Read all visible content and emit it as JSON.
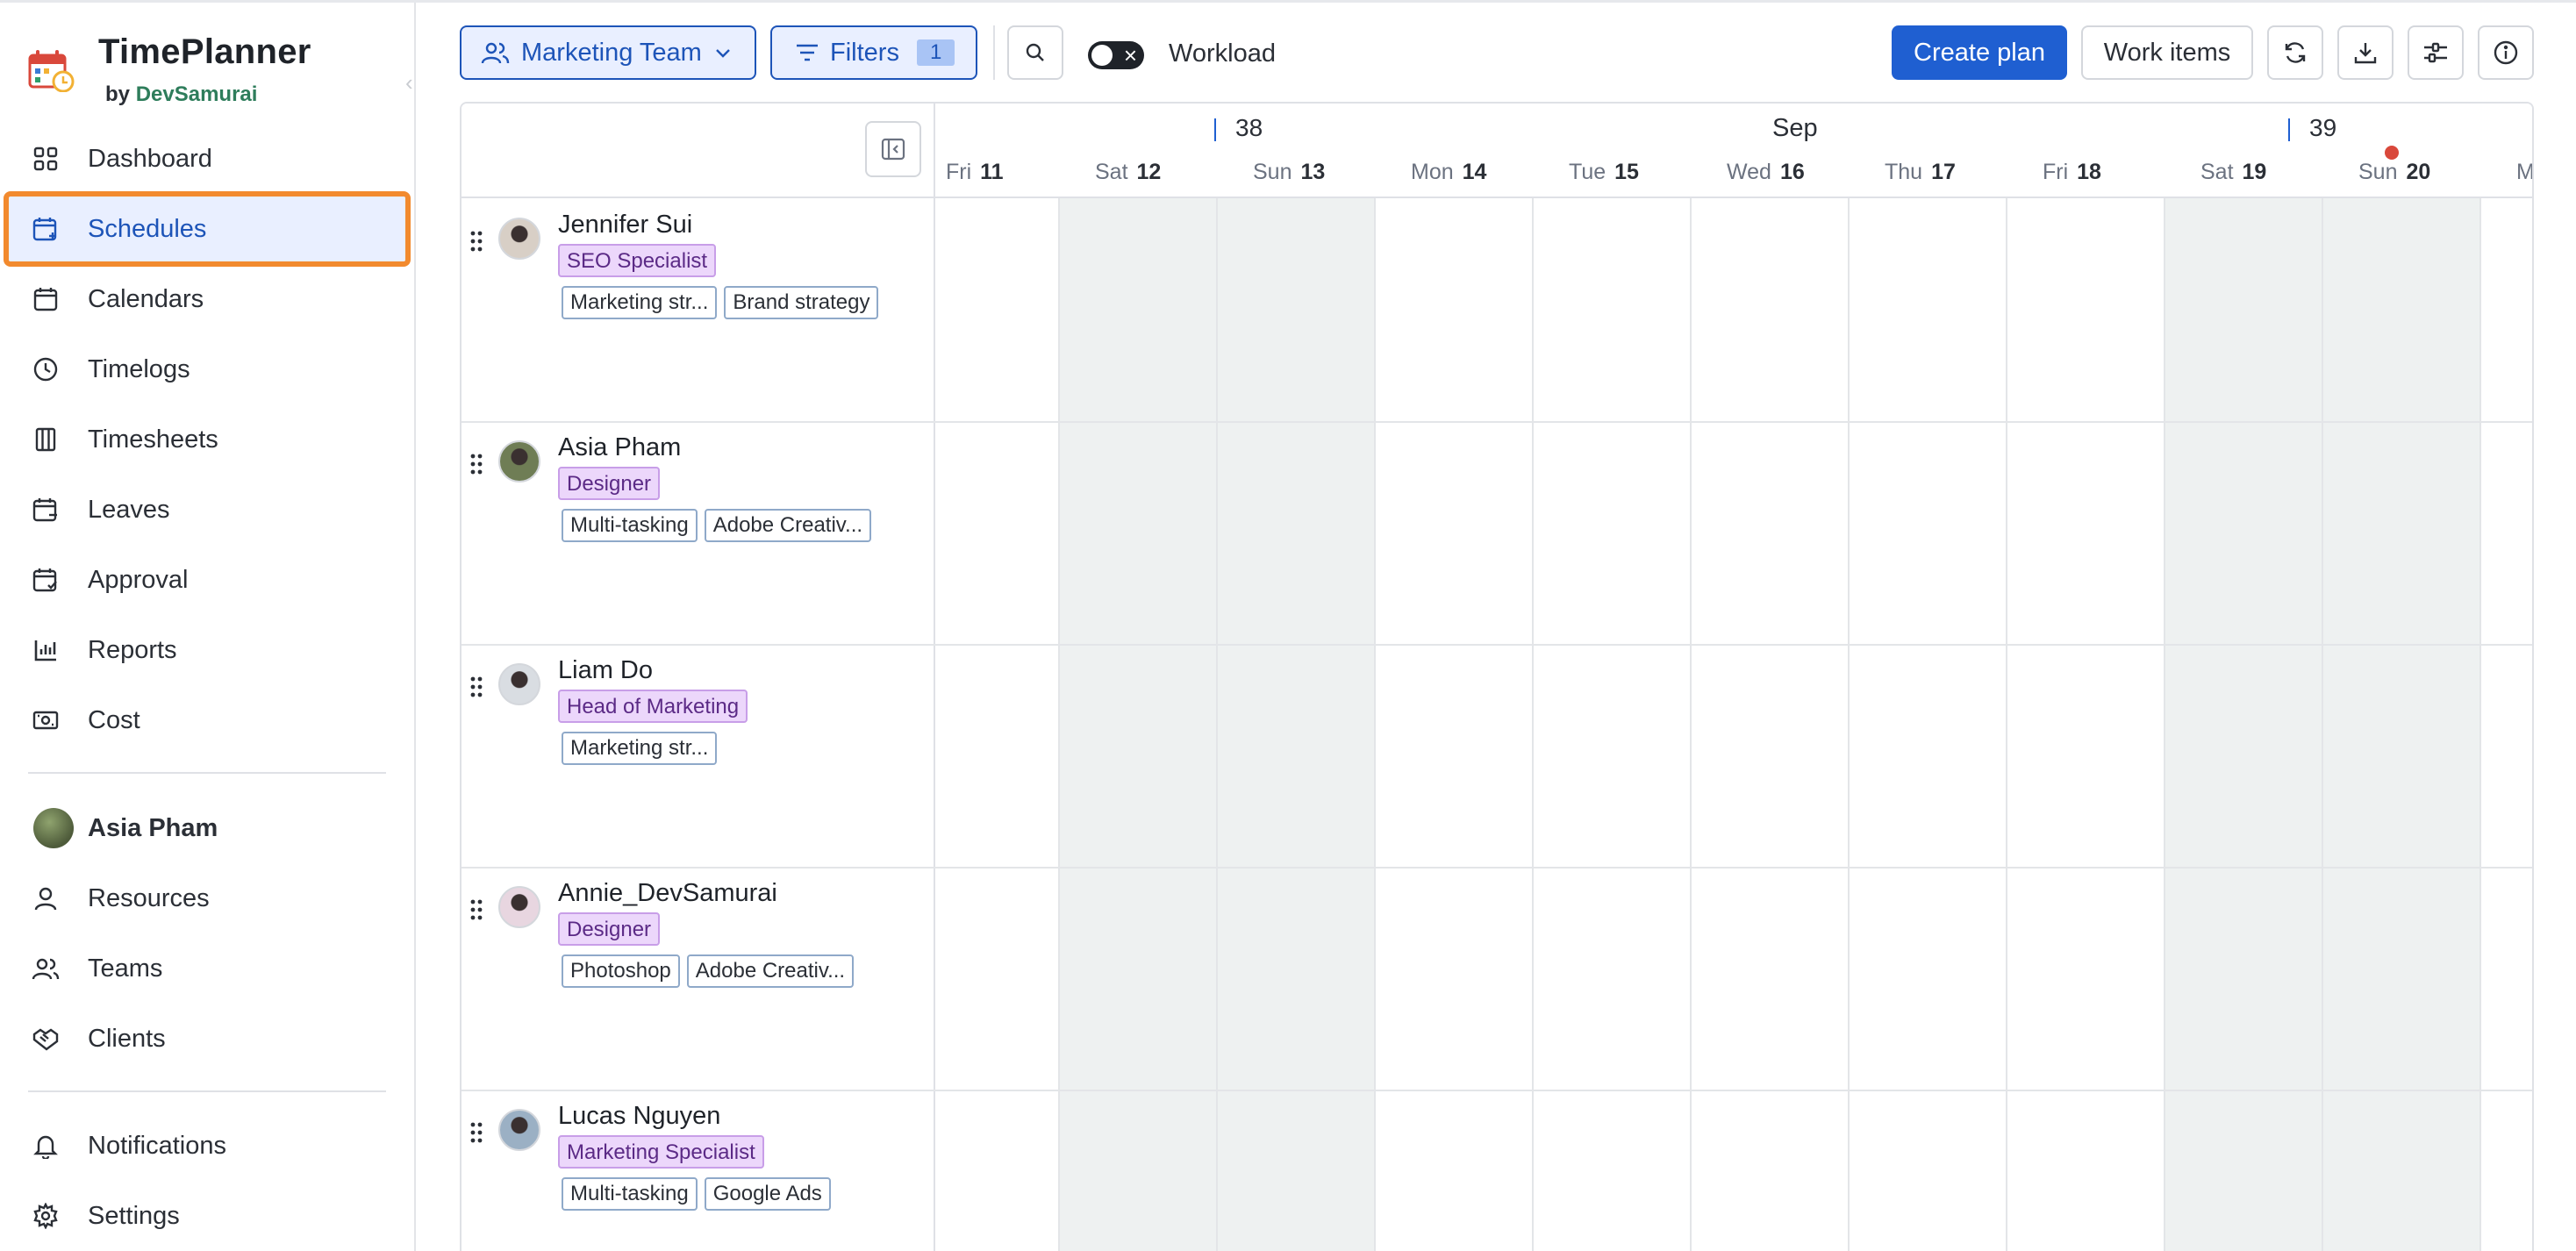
{
  "brand": {
    "name": "TimePlanner",
    "by": "by",
    "company": "DevSamurai"
  },
  "sidebar": {
    "items": [
      {
        "label": "Dashboard",
        "icon": "dashboard-icon"
      },
      {
        "label": "Schedules",
        "icon": "calendar-plus-icon",
        "active": true
      },
      {
        "label": "Calendars",
        "icon": "calendar-icon"
      },
      {
        "label": "Timelogs",
        "icon": "clock-icon"
      },
      {
        "label": "Timesheets",
        "icon": "columns-icon"
      },
      {
        "label": "Leaves",
        "icon": "calendar-leave-icon"
      },
      {
        "label": "Approval",
        "icon": "calendar-check-icon"
      },
      {
        "label": "Reports",
        "icon": "bar-chart-icon"
      },
      {
        "label": "Cost",
        "icon": "money-icon"
      }
    ],
    "user": {
      "name": "Asia Pham"
    },
    "admin_items": [
      {
        "label": "Resources",
        "icon": "user-icon"
      },
      {
        "label": "Teams",
        "icon": "users-icon"
      },
      {
        "label": "Clients",
        "icon": "handshake-icon"
      }
    ],
    "bottom_items": [
      {
        "label": "Notifications",
        "icon": "bell-icon"
      },
      {
        "label": "Settings",
        "icon": "gear-icon"
      }
    ]
  },
  "toolbar": {
    "team_label": "Marketing Team",
    "filters_label": "Filters",
    "filters_count": "1",
    "workload_label": "Workload",
    "create_plan_label": "Create plan",
    "work_items_label": "Work items"
  },
  "calendar": {
    "week_a": "38",
    "month": "Sep",
    "week_b": "39",
    "days": [
      {
        "dow": "Fri",
        "num": "11",
        "weekend": false
      },
      {
        "dow": "Sat",
        "num": "12",
        "weekend": true
      },
      {
        "dow": "Sun",
        "num": "13",
        "weekend": true
      },
      {
        "dow": "Mon",
        "num": "14",
        "weekend": false
      },
      {
        "dow": "Tue",
        "num": "15",
        "weekend": false
      },
      {
        "dow": "Wed",
        "num": "16",
        "weekend": false
      },
      {
        "dow": "Thu",
        "num": "17",
        "weekend": false
      },
      {
        "dow": "Fri",
        "num": "18",
        "weekend": false
      },
      {
        "dow": "Sat",
        "num": "19",
        "weekend": true
      },
      {
        "dow": "Sun",
        "num": "20",
        "weekend": true
      },
      {
        "dow": "M",
        "num": "",
        "weekend": false
      }
    ]
  },
  "people": [
    {
      "name": "Jennifer Sui",
      "role": "SEO Specialist",
      "tags": [
        "Marketing str...",
        "Brand strategy"
      ]
    },
    {
      "name": "Asia Pham",
      "role": "Designer",
      "tags": [
        "Multi-tasking",
        "Adobe Creativ..."
      ]
    },
    {
      "name": "Liam Do",
      "role": "Head of Marketing",
      "tags": [
        "Marketing str..."
      ]
    },
    {
      "name": "Annie_DevSamurai",
      "role": "Designer",
      "tags": [
        "Photoshop",
        "Adobe Creativ..."
      ]
    },
    {
      "name": "Lucas Nguyen",
      "role": "Marketing Specialist",
      "tags": [
        "Multi-tasking",
        "Google Ads"
      ]
    }
  ]
}
